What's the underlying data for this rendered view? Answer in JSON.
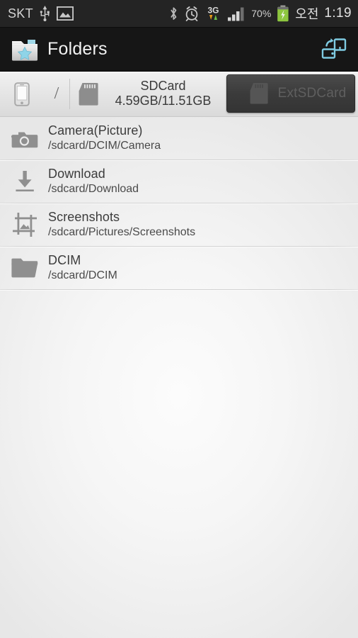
{
  "statusbar": {
    "carrier": "SKT",
    "icons_left": [
      "usb-icon",
      "screenshot-captured-icon"
    ],
    "icons_right": [
      "bluetooth-icon",
      "alarm-icon",
      "3g-data-icon",
      "signal-bars-icon"
    ],
    "battery_percent": "70%",
    "battery_state": "charging",
    "ampm": "오전",
    "time": "1:19"
  },
  "actionbar": {
    "app_icon": "folder-star-icon",
    "title": "Folders",
    "switch_storage_icon": "storage-switch-icon",
    "accent": "#8fd4e8"
  },
  "tabbar": {
    "phone_icon": "phone-icon",
    "separator": "/",
    "sdcard": {
      "icon": "sdcard-icon",
      "name": "SDCard",
      "usage": "4.59GB/11.51GB",
      "selected": true
    },
    "extsdcard": {
      "icon": "sdcard-icon",
      "label": "ExtSDCard",
      "selected": false,
      "enabled": false
    }
  },
  "list": {
    "items": [
      {
        "icon": "camera-icon",
        "name": "Camera(Picture)",
        "path": "/sdcard/DCIM/Camera"
      },
      {
        "icon": "download-icon",
        "name": "Download",
        "path": "/sdcard/Download"
      },
      {
        "icon": "screenshot-icon",
        "name": "Screenshots",
        "path": "/sdcard/Pictures/Screenshots"
      },
      {
        "icon": "folder-icon",
        "name": "DCIM",
        "path": "/sdcard/DCIM"
      }
    ]
  },
  "colors": {
    "statusbar_bg": "#242424",
    "actionbar_bg": "#161616",
    "accent_cyan": "#8fd4e8",
    "icon_gray": "#8b8b8b",
    "page_bg": "#f4f4f4"
  }
}
